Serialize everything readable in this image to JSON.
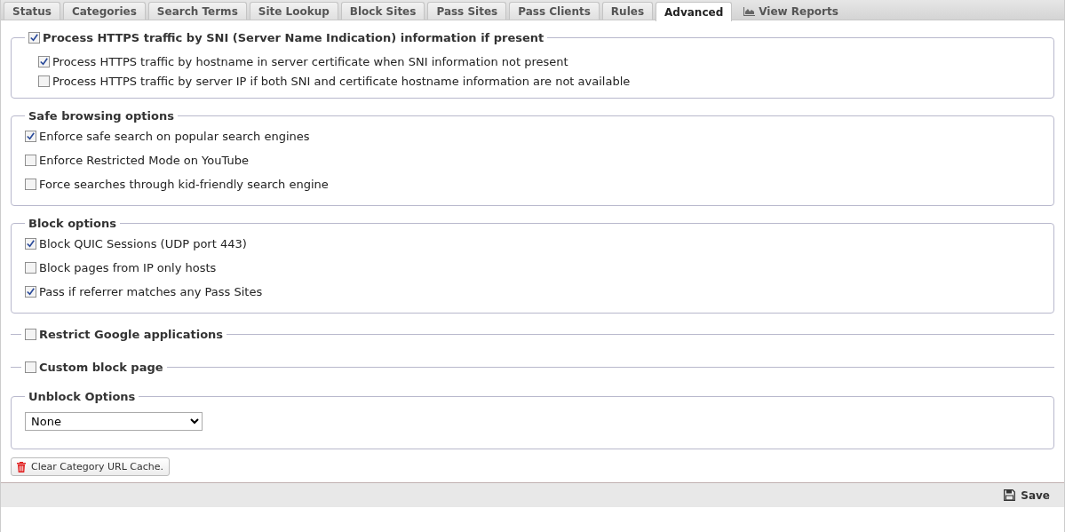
{
  "tabs": [
    {
      "label": "Status",
      "selected": false
    },
    {
      "label": "Categories",
      "selected": false
    },
    {
      "label": "Search Terms",
      "selected": false
    },
    {
      "label": "Site Lookup",
      "selected": false
    },
    {
      "label": "Block Sites",
      "selected": false
    },
    {
      "label": "Pass Sites",
      "selected": false
    },
    {
      "label": "Pass Clients",
      "selected": false
    },
    {
      "label": "Rules",
      "selected": false
    },
    {
      "label": "Advanced",
      "selected": true
    },
    {
      "label": "View Reports",
      "selected": false,
      "kind": "report"
    }
  ],
  "sections": [
    {
      "kind": "checkgroup",
      "legend": {
        "label": "Process HTTPS traffic by SNI (Server Name Indication) information if present",
        "checked": true
      },
      "options": [
        {
          "label": "Process HTTPS traffic by hostname in server certificate when SNI information not present",
          "checked": true
        },
        {
          "label": "Process HTTPS traffic by server IP if both SNI and certificate hostname information are not available",
          "checked": false
        }
      ]
    },
    {
      "kind": "group",
      "legend": "Safe browsing options",
      "options": [
        {
          "label": "Enforce safe search on popular search engines",
          "checked": true
        },
        {
          "label": "Enforce Restricted Mode on YouTube",
          "checked": false
        },
        {
          "label": "Force searches through kid-friendly search engine",
          "checked": false
        }
      ]
    },
    {
      "kind": "group",
      "legend": "Block options",
      "options": [
        {
          "label": "Block QUIC Sessions (UDP port 443)",
          "checked": true
        },
        {
          "label": "Block pages from IP only hosts",
          "checked": false
        },
        {
          "label": "Pass if referrer matches any Pass Sites",
          "checked": true
        }
      ]
    },
    {
      "kind": "collapsed",
      "legend": {
        "label": "Restrict Google applications",
        "checked": false
      }
    },
    {
      "kind": "collapsed",
      "legend": {
        "label": "Custom block page",
        "checked": false
      }
    },
    {
      "kind": "select",
      "legend": "Unblock Options",
      "value": "None"
    }
  ],
  "clear_button": "Clear Category URL Cache.",
  "save_button": "Save"
}
